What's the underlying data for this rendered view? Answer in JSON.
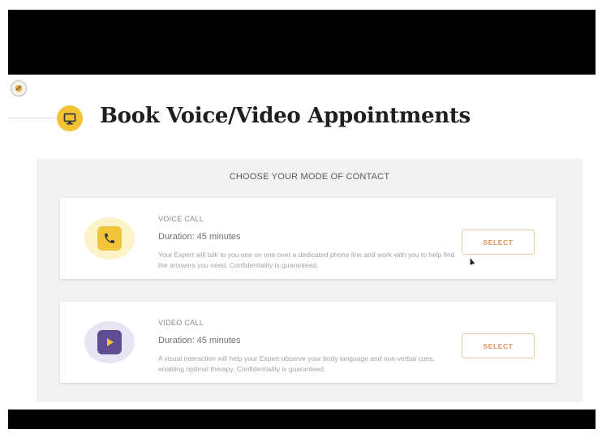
{
  "page": {
    "title": "Book Voice/Video Appointments",
    "logo_icon": "brand-logo-icon",
    "title_icon": "monitor-icon"
  },
  "panel": {
    "heading": "CHOOSE YOUR MODE OF CONTACT"
  },
  "options": [
    {
      "icon": "phone-icon",
      "label": "VOICE CALL",
      "duration": "Duration: 45 minutes",
      "description": "Your Expert will talk to you one on one over a dedicated phone line and work with you to help find the answers you need. Confidentiality is guaranteed.",
      "button": "SELECT"
    },
    {
      "icon": "play-icon",
      "label": "VIDEO CALL",
      "duration": "Duration: 45 minutes",
      "description": "A visual interaction will help your Expert observe your body language and non-verbal cues, enabling optimal therapy. Confidentiality is guaranteed.",
      "button": "SELECT"
    }
  ],
  "colors": {
    "accent_yellow": "#f3c234",
    "video_purple": "#5f4d92",
    "select_orange": "#e2915e"
  }
}
